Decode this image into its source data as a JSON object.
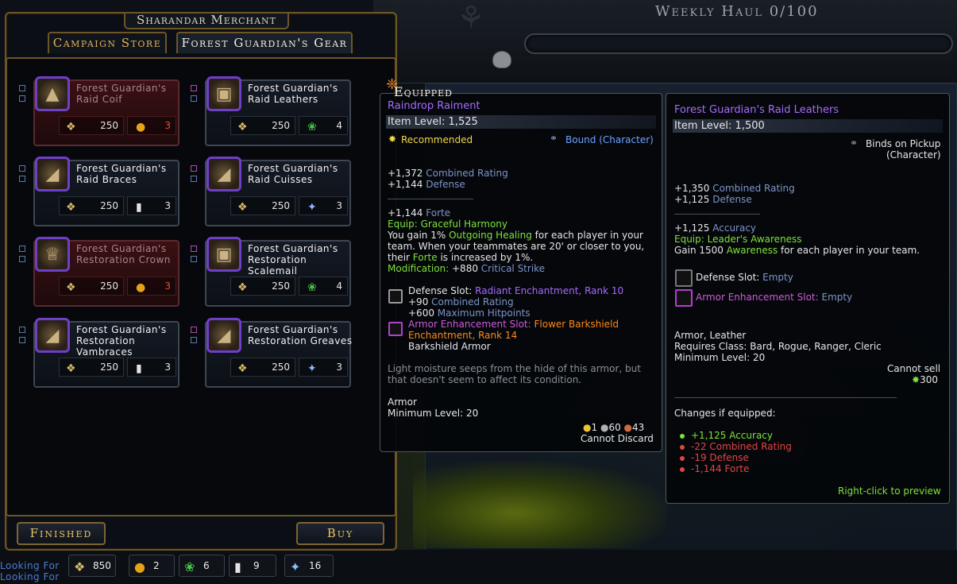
{
  "background": {
    "weekly_haul": "Weekly Haul 0/100"
  },
  "merchant": {
    "title": "Sharandar Merchant",
    "tabs": [
      "Campaign Store",
      "Forest Guardian's Gear"
    ],
    "items": [
      {
        "name": "Forest Guardian's Raid Coif",
        "unaffordable": true,
        "cost1": "250",
        "cost2": "3",
        "cost2_icon": "gold-apple-icon",
        "icon": "hood-icon"
      },
      {
        "name": "Forest Guardian's Raid Leathers",
        "unaffordable": false,
        "cost1": "250",
        "cost2": "4",
        "cost2_icon": "green-leaf-icon",
        "icon": "leather-armor-icon"
      },
      {
        "name": "Forest Guardian's Raid Braces",
        "unaffordable": false,
        "cost1": "250",
        "cost2": "3",
        "cost2_icon": "potion-icon",
        "icon": "bracer-icon"
      },
      {
        "name": "Forest Guardian's Raid Cuisses",
        "unaffordable": false,
        "cost1": "250",
        "cost2": "3",
        "cost2_icon": "shooting-star-icon",
        "icon": "boots-icon"
      },
      {
        "name": "Forest Guardian's Restoration Crown",
        "unaffordable": true,
        "cost1": "250",
        "cost2": "3",
        "cost2_icon": "gold-apple-icon",
        "icon": "crown-icon"
      },
      {
        "name": "Forest Guardian's Restoration Scalemail",
        "unaffordable": false,
        "cost1": "250",
        "cost2": "4",
        "cost2_icon": "green-leaf-icon",
        "icon": "scalemail-icon"
      },
      {
        "name": "Forest Guardian's Restoration Vambraces",
        "unaffordable": false,
        "cost1": "250",
        "cost2": "3",
        "cost2_icon": "potion-icon",
        "icon": "vambrace-icon"
      },
      {
        "name": "Forest Guardian's Restoration Greaves",
        "unaffordable": false,
        "cost1": "250",
        "cost2": "3",
        "cost2_icon": "shooting-star-icon",
        "icon": "greaves-icon"
      }
    ],
    "buttons": {
      "finished": "Finished",
      "buy": "Buy"
    }
  },
  "currencies": [
    {
      "icon": "scroll-icon",
      "value": "850"
    },
    {
      "icon": "gold-apple-icon",
      "value": "2"
    },
    {
      "icon": "green-leaf-icon",
      "value": "6"
    },
    {
      "icon": "potion-icon",
      "value": "9"
    },
    {
      "icon": "shooting-star-icon",
      "value": "16"
    }
  ],
  "looking_for": [
    "Looking For",
    "Looking For"
  ],
  "equipped_tip": {
    "header": "Equipped",
    "name": "Raindrop Raiment",
    "item_level": "Item Level: 1,525",
    "recommended": "Recommended",
    "bound": "Bound (Character)",
    "stat1_val": "+1,372",
    "stat1_name": "Combined Rating",
    "stat2_val": "+1,144",
    "stat2_name": "Defense",
    "forte_val": "+1,144",
    "forte_name": "Forte",
    "equip": "Equip: Graceful Harmony",
    "desc1_a": "You gain 1% ",
    "desc1_b": "Outgoing Healing",
    "desc1_c": " for each player in your",
    "desc2": "team. When your teammates are 20' or closer to you,",
    "desc3_a": "their ",
    "desc3_b": "Forte",
    "desc3_c": " is increased by 1%.",
    "modification_a": "Modification: ",
    "modification_b": "+880 ",
    "modification_c": "Critical Strike",
    "defense_slot_label": "Defense Slot: ",
    "defense_slot_value": "Radiant Enchantment, Rank 10",
    "ds_stat1_val": "+90 ",
    "ds_stat1_name": "Combined Rating",
    "ds_stat2_val": "+600 ",
    "ds_stat2_name": "Maximum Hitpoints",
    "armor_slot_label": "Armor Enhancement Slot: ",
    "armor_slot_value1": "Flower Barkshield",
    "armor_slot_value2": "Enchantment, Rank 14",
    "armor_slot_sub": "Barkshield Armor",
    "flavor1": "Light moisture seeps from the hide of this armor, but",
    "flavor2": "that doesn't seem to affect its condition.",
    "type": "Armor",
    "min_level": "Minimum Level: 20",
    "price_gold": "1",
    "price_silver": "60",
    "price_copper": "43",
    "discard": "Cannot Discard"
  },
  "compare_tip": {
    "name": "Forest Guardian's Raid Leathers",
    "item_level": "Item Level: 1,500",
    "binds1": "Binds on Pickup",
    "binds2": "(Character)",
    "stat1_val": "+1,350",
    "stat1_name": "Combined Rating",
    "stat2_val": "+1,125",
    "stat2_name": "Defense",
    "acc_val": "+1,125",
    "acc_name": "Accuracy",
    "equip": "Equip: Leader's Awareness",
    "desc_a": "Gain 1500 ",
    "desc_b": "Awareness",
    "desc_c": " for each player in your team.",
    "defense_slot_label": "Defense Slot: ",
    "defense_slot_value": "Empty",
    "armor_slot_label": "Armor Enhancement Slot: ",
    "armor_slot_value": "Empty",
    "type": "Armor, Leather",
    "requires": "Requires Class: Bard, Rogue, Ranger, Cleric",
    "min_level": "Minimum Level: 20",
    "cannot_sell": "Cannot sell",
    "price": "300",
    "changes_header": "Changes if equipped:",
    "changes": [
      {
        "text": "+1,125 Accuracy",
        "color": "#7ee23a"
      },
      {
        "text": "-22 Combined Rating",
        "color": "#e34444"
      },
      {
        "text": "-19 Defense",
        "color": "#e34444"
      },
      {
        "text": "-1,144 Forte",
        "color": "#e34444"
      }
    ],
    "preview": "Right-click to preview"
  }
}
